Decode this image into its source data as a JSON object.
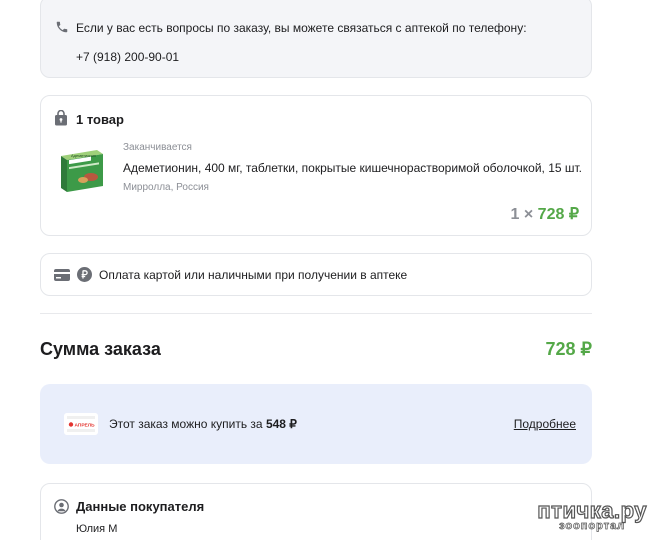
{
  "contact": {
    "message": "Если у вас есть вопросы по заказу, вы можете связаться с аптекой по телефону:",
    "phone": "+7 (918) 200-90-01"
  },
  "product_block": {
    "count_title": "1 товар",
    "item": {
      "status": "Заканчивается",
      "name": "Адеметионин, 400 мг, таблетки, покрытые кишечнорастворимой оболочкой, 15 шт.",
      "maker": "Мирролла, Россия",
      "quantity": "1 ×",
      "price": "728 ₽",
      "box_label": "Адеметионин"
    }
  },
  "payment": {
    "text": "Оплата картой или наличными при получении в аптеке"
  },
  "summary": {
    "label": "Сумма заказа",
    "value": "728 ₽"
  },
  "promo": {
    "logo_text": "АПРЕЛЬ",
    "text_prefix": "Этот заказ можно купить за",
    "price": "548 ₽",
    "link": "Подробнее"
  },
  "buyer": {
    "title": "Данные покупателя",
    "name": "Юлия М"
  },
  "watermark": {
    "main": "птичка.ру",
    "sub": "зоопортал"
  },
  "colors": {
    "accent_green": "#54a848",
    "promo_bg": "#e9eefb",
    "muted": "#8c8f96"
  },
  "icons": [
    "phone-icon",
    "bag-lock-icon",
    "credit-card-icon",
    "ruble-icon",
    "user-icon"
  ]
}
